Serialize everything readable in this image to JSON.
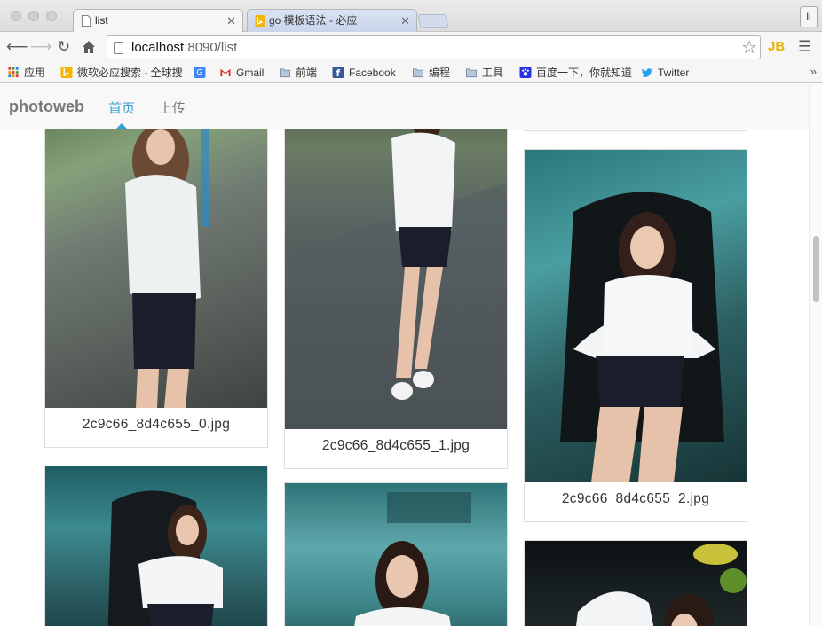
{
  "browser": {
    "tabs": [
      {
        "title": "list",
        "icon": "page-icon",
        "active": true
      },
      {
        "title": "go 模板语法 - 必应",
        "icon": "bing-icon",
        "active": false
      }
    ],
    "profile_label": "li",
    "url_host": "localhost",
    "url_rest": ":8090/list",
    "bookmarks": [
      {
        "label": "应用",
        "icon": "apps-grid-icon"
      },
      {
        "label": "微软必应搜索 - 全球搜",
        "icon": "bing-icon"
      },
      {
        "label": "",
        "icon": "translate-icon"
      },
      {
        "label": "Gmail",
        "icon": "gmail-icon"
      },
      {
        "label": "前端",
        "icon": "folder-icon"
      },
      {
        "label": "Facebook",
        "icon": "facebook-icon"
      },
      {
        "label": "编程",
        "icon": "folder-icon"
      },
      {
        "label": "工具",
        "icon": "folder-icon"
      },
      {
        "label": "百度一下，你就知道",
        "icon": "baidu-icon"
      },
      {
        "label": "Twitter",
        "icon": "twitter-icon"
      }
    ],
    "more_bookmarks": "»"
  },
  "site": {
    "brand": "photoweb",
    "nav": [
      {
        "label": "首页",
        "active": true
      },
      {
        "label": "上传",
        "active": false
      }
    ]
  },
  "photos": [
    {
      "filename": "2c9c66_8d4c655_0.jpg"
    },
    {
      "filename": "2c9c66_8d4c655_1.jpg"
    },
    {
      "filename": "2c9c66_8d4c655_2.jpg"
    },
    {
      "filename": ""
    },
    {
      "filename": ""
    },
    {
      "filename": ""
    }
  ],
  "colors": {
    "accent": "#3a9fd6",
    "navbar_bg": "#f8f8f8",
    "brand_text": "#777777"
  }
}
